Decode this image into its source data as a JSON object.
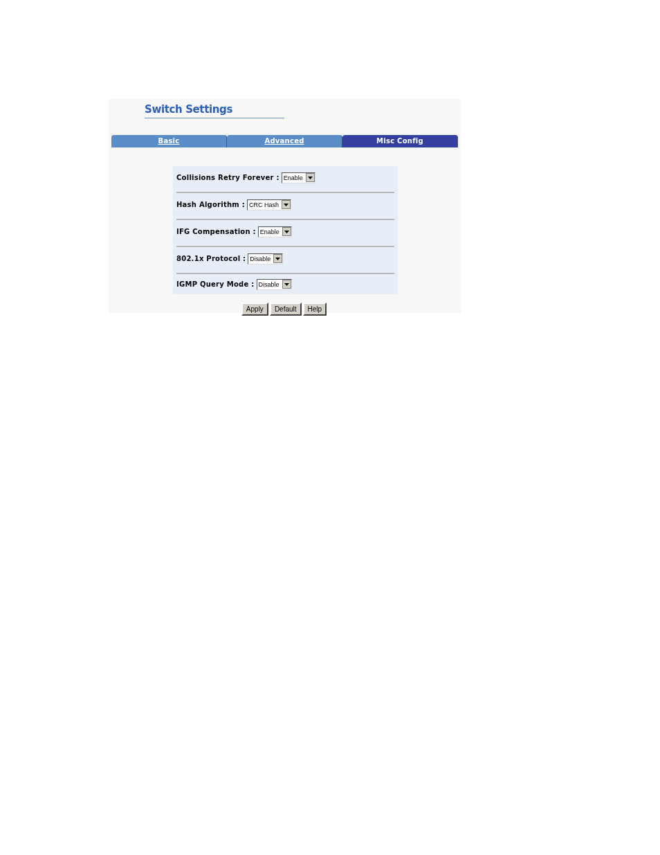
{
  "title": "Switch Settings",
  "tabs": [
    {
      "label": "Basic",
      "selected": false
    },
    {
      "label": "Advanced",
      "selected": false
    },
    {
      "label": "Misc Config",
      "selected": true
    }
  ],
  "settings": [
    {
      "label": "Collisions Retry Forever :",
      "value": "Enable"
    },
    {
      "label": "Hash Algorithm :",
      "value": "CRC Hash"
    },
    {
      "label": "IFG Compensation :",
      "value": "Enable"
    },
    {
      "label": "802.1x Protocol :",
      "value": "Disable"
    },
    {
      "label": "IGMP Query Mode :",
      "value": "Disable"
    }
  ],
  "buttons": [
    "Apply",
    "Default",
    "Help"
  ]
}
